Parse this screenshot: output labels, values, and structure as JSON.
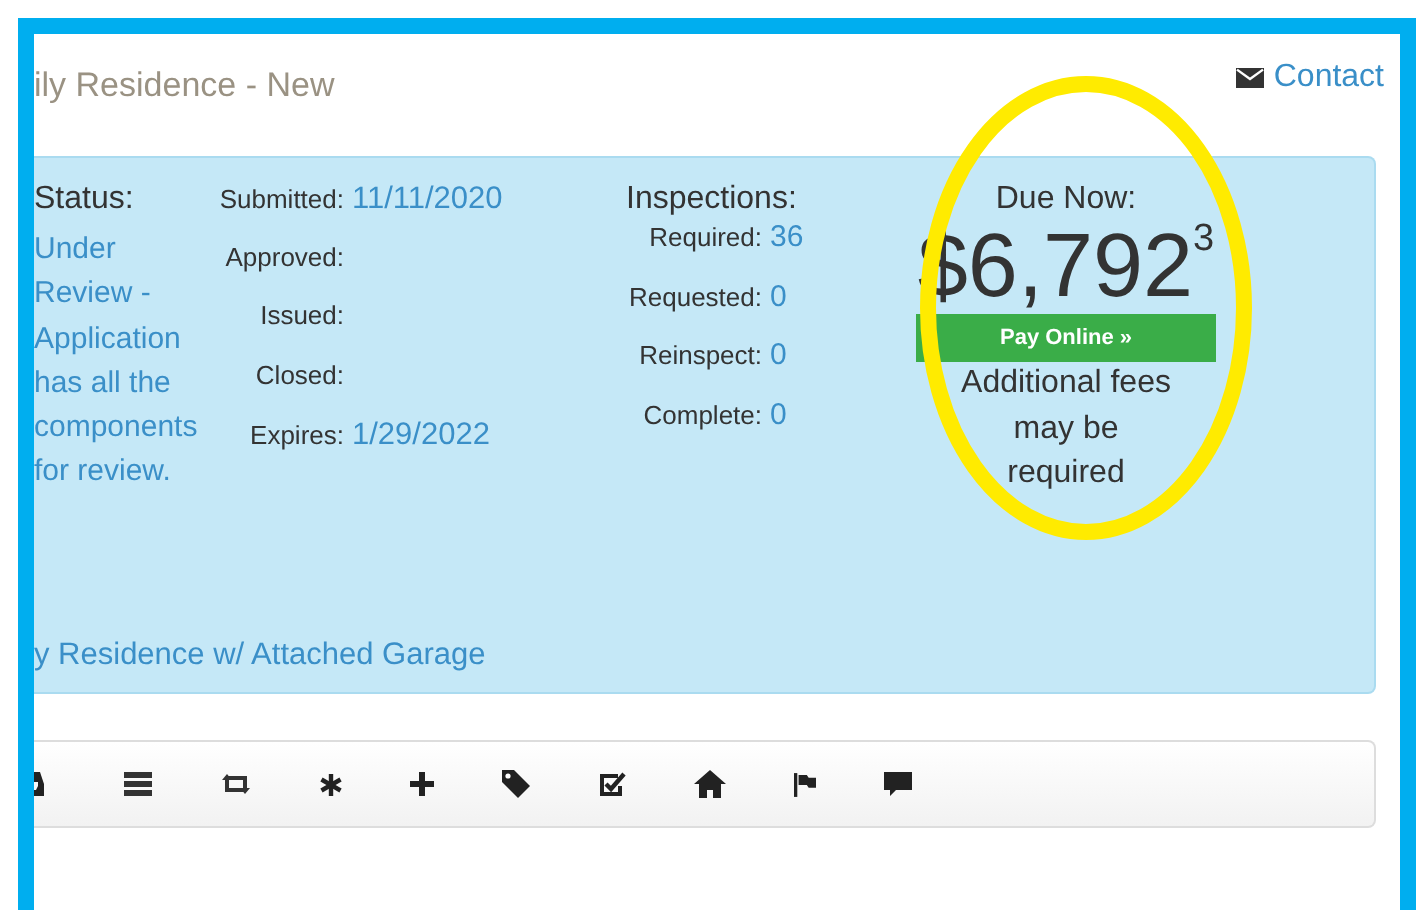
{
  "title": "ily Residence - New",
  "contact": {
    "label": "Contact"
  },
  "status": {
    "label": "Status:",
    "value": "Under Review - Application has all the components for review."
  },
  "dates": [
    {
      "label": "Submitted:",
      "value": "11/11/2020"
    },
    {
      "label": "Approved:"
    },
    {
      "label": "Issued:"
    },
    {
      "label": "Closed:"
    },
    {
      "label": "Expires:",
      "value": "1/29/2022"
    }
  ],
  "inspections": {
    "title": "Inspections:",
    "rows": [
      {
        "label": "Required:",
        "value": "36"
      },
      {
        "label": "Requested:",
        "value": "0"
      },
      {
        "label": "Reinspect:",
        "value": "0"
      },
      {
        "label": "Complete:",
        "value": "0"
      }
    ]
  },
  "due": {
    "label": "Due Now:",
    "amount": "$6,792",
    "cents": "3",
    "button": "Pay Online »",
    "note": "Additional fees may be required"
  },
  "description": "y Residence w/ Attached Garage"
}
